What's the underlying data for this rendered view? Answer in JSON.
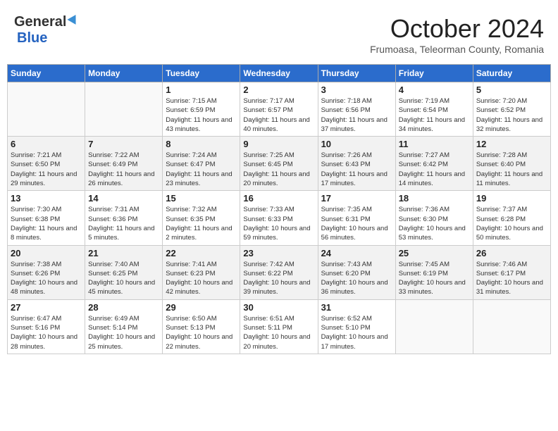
{
  "header": {
    "logo_general": "General",
    "logo_blue": "Blue",
    "month_title": "October 2024",
    "location": "Frumoasa, Teleorman County, Romania"
  },
  "days_of_week": [
    "Sunday",
    "Monday",
    "Tuesday",
    "Wednesday",
    "Thursday",
    "Friday",
    "Saturday"
  ],
  "weeks": [
    [
      {
        "day": "",
        "info": ""
      },
      {
        "day": "",
        "info": ""
      },
      {
        "day": "1",
        "info": "Sunrise: 7:15 AM\nSunset: 6:59 PM\nDaylight: 11 hours and 43 minutes."
      },
      {
        "day": "2",
        "info": "Sunrise: 7:17 AM\nSunset: 6:57 PM\nDaylight: 11 hours and 40 minutes."
      },
      {
        "day": "3",
        "info": "Sunrise: 7:18 AM\nSunset: 6:56 PM\nDaylight: 11 hours and 37 minutes."
      },
      {
        "day": "4",
        "info": "Sunrise: 7:19 AM\nSunset: 6:54 PM\nDaylight: 11 hours and 34 minutes."
      },
      {
        "day": "5",
        "info": "Sunrise: 7:20 AM\nSunset: 6:52 PM\nDaylight: 11 hours and 32 minutes."
      }
    ],
    [
      {
        "day": "6",
        "info": "Sunrise: 7:21 AM\nSunset: 6:50 PM\nDaylight: 11 hours and 29 minutes."
      },
      {
        "day": "7",
        "info": "Sunrise: 7:22 AM\nSunset: 6:49 PM\nDaylight: 11 hours and 26 minutes."
      },
      {
        "day": "8",
        "info": "Sunrise: 7:24 AM\nSunset: 6:47 PM\nDaylight: 11 hours and 23 minutes."
      },
      {
        "day": "9",
        "info": "Sunrise: 7:25 AM\nSunset: 6:45 PM\nDaylight: 11 hours and 20 minutes."
      },
      {
        "day": "10",
        "info": "Sunrise: 7:26 AM\nSunset: 6:43 PM\nDaylight: 11 hours and 17 minutes."
      },
      {
        "day": "11",
        "info": "Sunrise: 7:27 AM\nSunset: 6:42 PM\nDaylight: 11 hours and 14 minutes."
      },
      {
        "day": "12",
        "info": "Sunrise: 7:28 AM\nSunset: 6:40 PM\nDaylight: 11 hours and 11 minutes."
      }
    ],
    [
      {
        "day": "13",
        "info": "Sunrise: 7:30 AM\nSunset: 6:38 PM\nDaylight: 11 hours and 8 minutes."
      },
      {
        "day": "14",
        "info": "Sunrise: 7:31 AM\nSunset: 6:36 PM\nDaylight: 11 hours and 5 minutes."
      },
      {
        "day": "15",
        "info": "Sunrise: 7:32 AM\nSunset: 6:35 PM\nDaylight: 11 hours and 2 minutes."
      },
      {
        "day": "16",
        "info": "Sunrise: 7:33 AM\nSunset: 6:33 PM\nDaylight: 10 hours and 59 minutes."
      },
      {
        "day": "17",
        "info": "Sunrise: 7:35 AM\nSunset: 6:31 PM\nDaylight: 10 hours and 56 minutes."
      },
      {
        "day": "18",
        "info": "Sunrise: 7:36 AM\nSunset: 6:30 PM\nDaylight: 10 hours and 53 minutes."
      },
      {
        "day": "19",
        "info": "Sunrise: 7:37 AM\nSunset: 6:28 PM\nDaylight: 10 hours and 50 minutes."
      }
    ],
    [
      {
        "day": "20",
        "info": "Sunrise: 7:38 AM\nSunset: 6:26 PM\nDaylight: 10 hours and 48 minutes."
      },
      {
        "day": "21",
        "info": "Sunrise: 7:40 AM\nSunset: 6:25 PM\nDaylight: 10 hours and 45 minutes."
      },
      {
        "day": "22",
        "info": "Sunrise: 7:41 AM\nSunset: 6:23 PM\nDaylight: 10 hours and 42 minutes."
      },
      {
        "day": "23",
        "info": "Sunrise: 7:42 AM\nSunset: 6:22 PM\nDaylight: 10 hours and 39 minutes."
      },
      {
        "day": "24",
        "info": "Sunrise: 7:43 AM\nSunset: 6:20 PM\nDaylight: 10 hours and 36 minutes."
      },
      {
        "day": "25",
        "info": "Sunrise: 7:45 AM\nSunset: 6:19 PM\nDaylight: 10 hours and 33 minutes."
      },
      {
        "day": "26",
        "info": "Sunrise: 7:46 AM\nSunset: 6:17 PM\nDaylight: 10 hours and 31 minutes."
      }
    ],
    [
      {
        "day": "27",
        "info": "Sunrise: 6:47 AM\nSunset: 5:16 PM\nDaylight: 10 hours and 28 minutes."
      },
      {
        "day": "28",
        "info": "Sunrise: 6:49 AM\nSunset: 5:14 PM\nDaylight: 10 hours and 25 minutes."
      },
      {
        "day": "29",
        "info": "Sunrise: 6:50 AM\nSunset: 5:13 PM\nDaylight: 10 hours and 22 minutes."
      },
      {
        "day": "30",
        "info": "Sunrise: 6:51 AM\nSunset: 5:11 PM\nDaylight: 10 hours and 20 minutes."
      },
      {
        "day": "31",
        "info": "Sunrise: 6:52 AM\nSunset: 5:10 PM\nDaylight: 10 hours and 17 minutes."
      },
      {
        "day": "",
        "info": ""
      },
      {
        "day": "",
        "info": ""
      }
    ]
  ],
  "row_styles": [
    "row-white",
    "row-shaded",
    "row-white",
    "row-shaded",
    "row-white"
  ]
}
